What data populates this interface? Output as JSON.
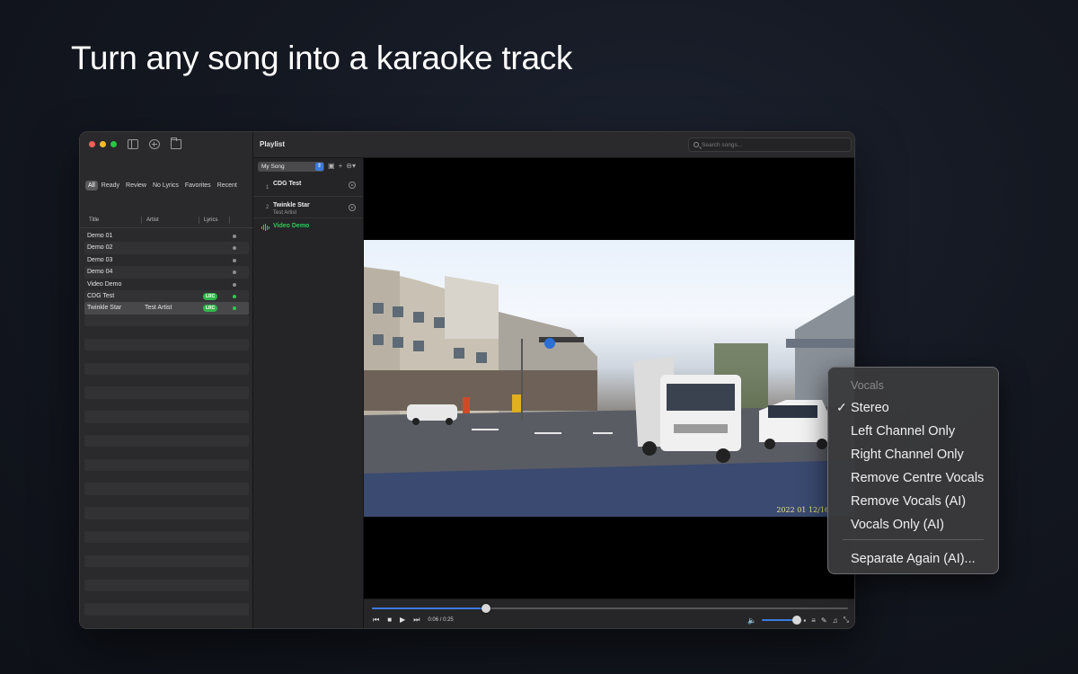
{
  "headline": "Turn any song into a karaoke track",
  "sidebar": {
    "filters": [
      "All",
      "Ready",
      "Review",
      "No Lyrics",
      "Favorites",
      "Recent"
    ],
    "active_filter": "All",
    "columns": {
      "title": "Title",
      "artist": "Artist",
      "lyrics": "Lyrics"
    },
    "songs": [
      {
        "title": "Demo 01",
        "artist": "",
        "lrc": ""
      },
      {
        "title": "Demo 02",
        "artist": "",
        "lrc": ""
      },
      {
        "title": "Demo 03",
        "artist": "",
        "lrc": ""
      },
      {
        "title": "Demo 04",
        "artist": "",
        "lrc": ""
      },
      {
        "title": "Video Demo",
        "artist": "",
        "lrc": ""
      },
      {
        "title": "CDG Test",
        "artist": "",
        "lrc": "LRC"
      },
      {
        "title": "Twinkle Star",
        "artist": "Test Artist",
        "lrc": "LRC"
      }
    ]
  },
  "playlist": {
    "title": "Playlist",
    "search_placeholder": "Search songs...",
    "selected_playlist": "My Song",
    "items": [
      {
        "num": "1",
        "name": "CDG Test",
        "artist": ""
      },
      {
        "num": "2",
        "name": "Twinkle Star",
        "artist": "Test Artist"
      },
      {
        "num": "",
        "name": "Video Demo",
        "artist": ""
      }
    ]
  },
  "player": {
    "time": "0:06 / 0:25",
    "progress": 0.24,
    "volume": 0.85,
    "video_timestamp": "2022 01 12/16"
  },
  "vocals_menu": {
    "header": "Vocals",
    "items": [
      "Stereo",
      "Left Channel Only",
      "Right Channel Only",
      "Remove Centre Vocals",
      "Remove Vocals (AI)",
      "Vocals Only (AI)"
    ],
    "checked": "Stereo",
    "action": "Separate Again (AI)..."
  },
  "colors": {
    "accent": "#3b7ae0",
    "playing": "#34c759",
    "lrc_badge": "#2fb74a"
  }
}
